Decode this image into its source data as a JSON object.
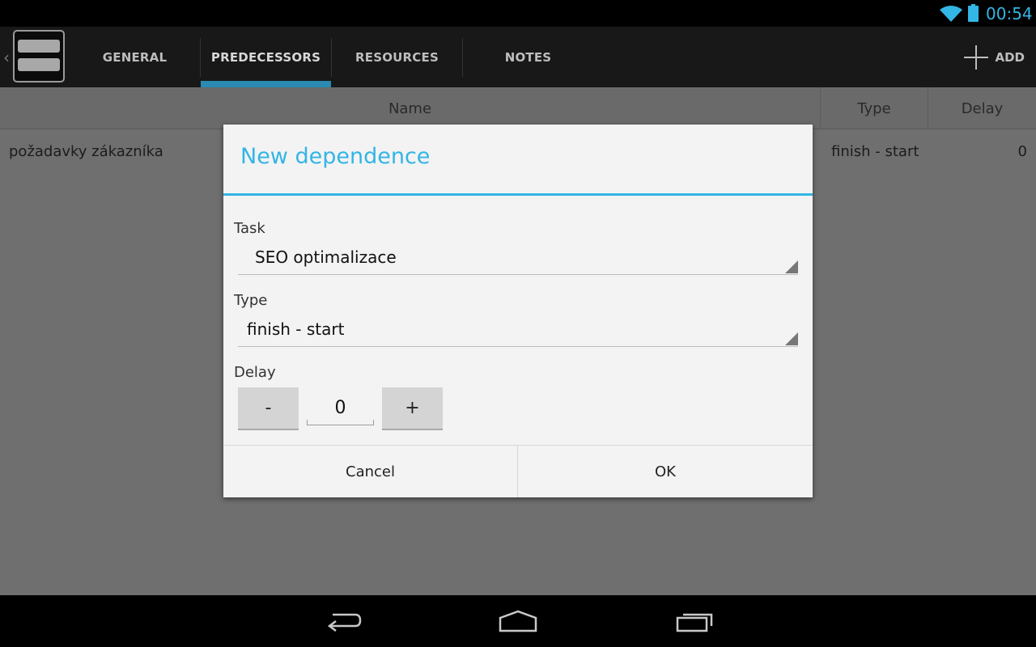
{
  "status_bar": {
    "time": "00:54",
    "wifi_icon": "wifi-icon",
    "battery_icon": "battery-icon",
    "accent_color": "#33b5e5"
  },
  "action_bar": {
    "app_icon": "app-icon",
    "tabs": [
      {
        "label": "GENERAL",
        "selected": false
      },
      {
        "label": "PREDECESSORS",
        "selected": true
      },
      {
        "label": "RESOURCES",
        "selected": false
      },
      {
        "label": "NOTES",
        "selected": false
      }
    ],
    "add_label": "ADD",
    "add_icon": "plus-icon"
  },
  "table": {
    "columns": [
      "Name",
      "Type",
      "Delay"
    ],
    "rows": [
      {
        "name": "požadavky zákazníka",
        "type": "finish - start",
        "delay": "0"
      }
    ]
  },
  "dialog": {
    "title": "New dependence",
    "title_color": "#33b5e5",
    "task_label": "Task",
    "task_value": "SEO optimalizace",
    "type_label": "Type",
    "type_value": "finish - start",
    "delay_label": "Delay",
    "decrement_label": "-",
    "delay_value": "0",
    "increment_label": "+",
    "cancel_label": "Cancel",
    "ok_label": "OK"
  },
  "nav_bar": {
    "back_icon": "back-icon",
    "home_icon": "home-icon",
    "recents_icon": "recents-icon"
  }
}
